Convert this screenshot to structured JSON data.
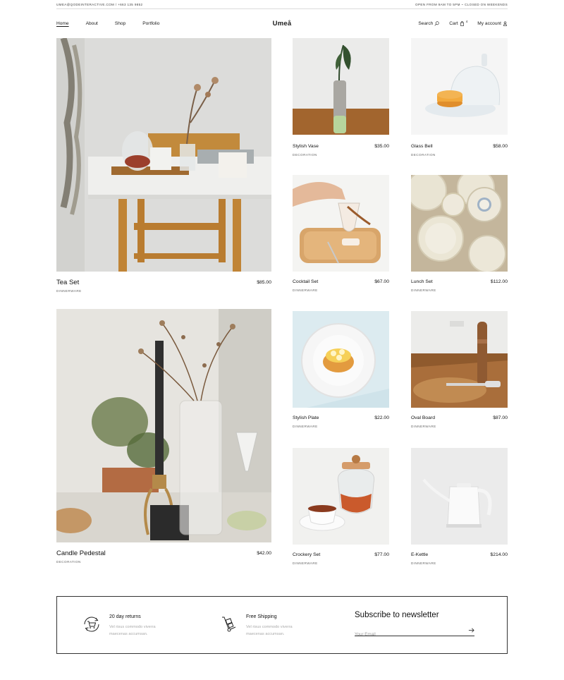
{
  "topbar": {
    "contact": "UMEA@QODEINTERACTIVE.COM / +663 135 9852",
    "hours": "OPEN FROM 9AM TO 5PM ~ CLOSED ON WEEKENDS"
  },
  "header": {
    "nav": [
      "Home",
      "About",
      "Shop",
      "Portfolio"
    ],
    "logo": "Umeå",
    "search_label": "Search",
    "cart_label": "Cart",
    "cart_count": "4",
    "account_label": "My account"
  },
  "products": [
    {
      "title": "Tea Set",
      "price": "$85.00",
      "category": "DINNERWARE"
    },
    {
      "title": "Stylish Vase",
      "price": "$35.00",
      "category": "DECORATION"
    },
    {
      "title": "Glass Bell",
      "price": "$58.00",
      "category": "DECORATION"
    },
    {
      "title": "Cocktail Set",
      "price": "$67.00",
      "category": "DINNERWARE"
    },
    {
      "title": "Lunch Set",
      "price": "$112.00",
      "category": "DINNERWARE"
    },
    {
      "title": "Candle Pedestal",
      "price": "$42.00",
      "category": "DECORATION"
    },
    {
      "title": "Stylish Plate",
      "price": "$22.00",
      "category": "DINNERWARE"
    },
    {
      "title": "Oval Board",
      "price": "$87.00",
      "category": "DINNERWARE"
    },
    {
      "title": "Crockery Set",
      "price": "$77.00",
      "category": "DINNERWARE"
    },
    {
      "title": "E-Kettle",
      "price": "$214.00",
      "category": "DINNERWARE"
    }
  ],
  "features": [
    {
      "title": "20 day returns",
      "desc": "Vel risus commodo viverra maecenas accumsan.",
      "icon": "cart-return-icon"
    },
    {
      "title": "Free Shipping",
      "desc": "Vel risus commodo viverra maecenas accumsan.",
      "icon": "hand-truck-icon"
    }
  ],
  "newsletter": {
    "title": "Subscribe to newsletter",
    "placeholder": "Your Email"
  }
}
